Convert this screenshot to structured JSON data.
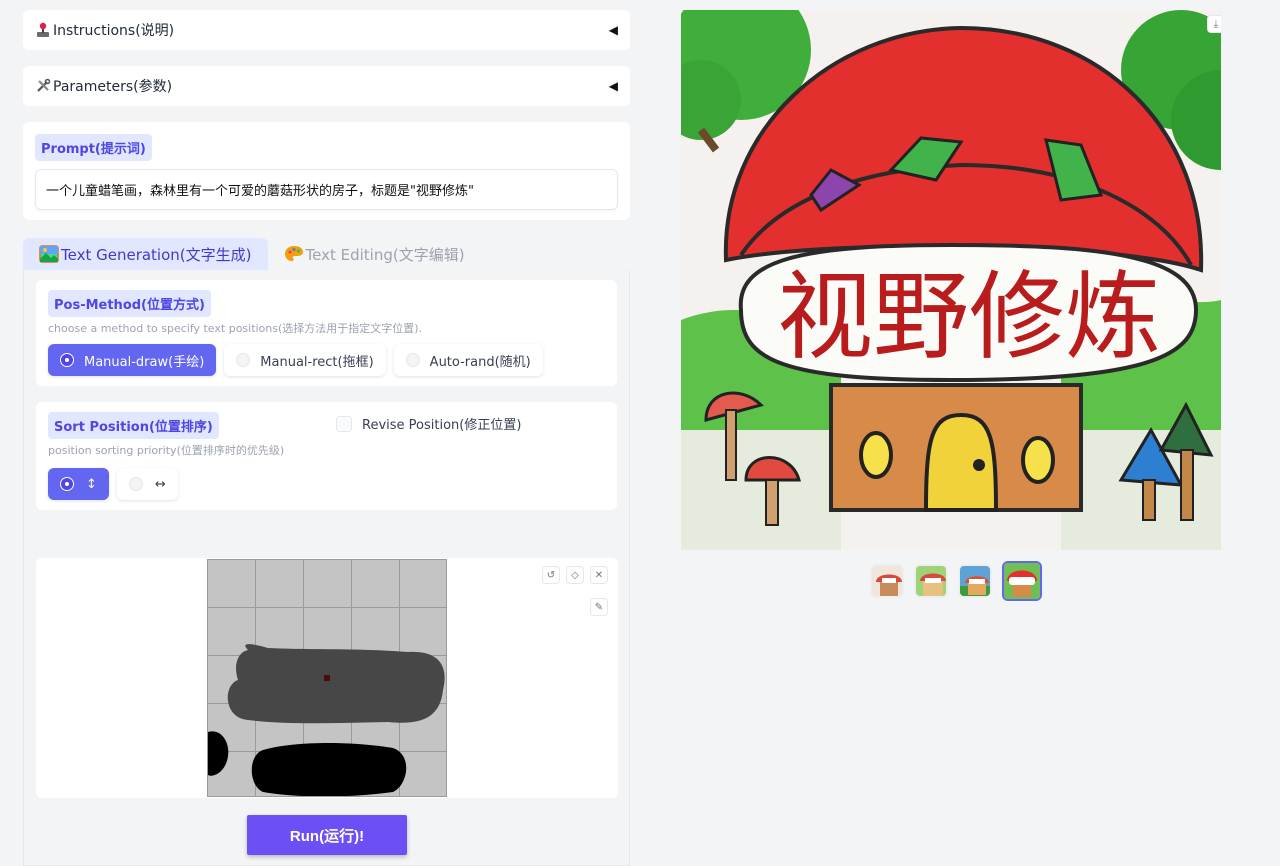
{
  "accordions": [
    {
      "label": "Instructions(说明)",
      "icon": "joystick-icon"
    },
    {
      "label": "Parameters(参数)",
      "icon": "tools-icon"
    }
  ],
  "prompt": {
    "label": "Prompt(提示词)",
    "value": "一个儿童蜡笔画，森林里有一个可爱的蘑菇形状的房子，标题是\"视野修炼\""
  },
  "tabs": [
    {
      "label": "Text Generation(文字生成)",
      "icon": "picture-icon",
      "active": true
    },
    {
      "label": "Text Editing(文字编辑)",
      "icon": "palette-icon",
      "active": false
    }
  ],
  "pos_method": {
    "label": "Pos-Method(位置方式)",
    "description": "choose a method to specify text positions(选择方法用于指定文字位置).",
    "options": [
      "Manual-draw(手绘)",
      "Manual-rect(拖框)",
      "Auto-rand(随机)"
    ],
    "selected": "Manual-draw(手绘)"
  },
  "sort_position": {
    "label": "Sort Position(位置排序)",
    "description": "position sorting priority(位置排序时的优先级)",
    "options": [
      "↕",
      "↔"
    ],
    "selected": "↕"
  },
  "revise_position": {
    "label": "Revise Position(修正位置)",
    "checked": false
  },
  "run_button": {
    "label": "Run(运行)!"
  },
  "output_image": {
    "title_text": "视野修炼",
    "thumbnail_count": 4,
    "selected_thumbnail": 4
  },
  "colors": {
    "accent": "#6366f1",
    "run": "#6d4ff6",
    "label_bg": "#e0e7ff"
  }
}
